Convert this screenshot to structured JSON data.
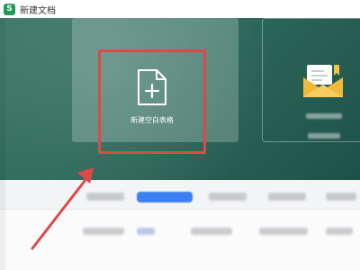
{
  "window": {
    "app_icon_letter": "S",
    "title": "新建文档"
  },
  "blank_card": {
    "label": "新建空白表格"
  },
  "colors": {
    "banner": "#2e6a5b",
    "highlight": "#e04848",
    "active_tab": "#3b7ff2",
    "arrow": "#e04848"
  },
  "icons": {
    "document": "doc-plus-icon",
    "template": "folder-mail-icon"
  }
}
